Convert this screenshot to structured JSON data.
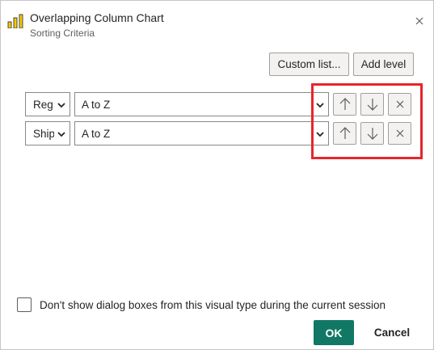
{
  "header": {
    "title": "Overlapping Column Chart",
    "subtitle": "Sorting Criteria",
    "app_icon": "column-chart-icon",
    "close_icon": "close-icon"
  },
  "toolbar": {
    "custom_list_label": "Custom list...",
    "add_level_label": "Add level"
  },
  "sort_rows": [
    {
      "field": "Reg",
      "order": "A to Z"
    },
    {
      "field": "Ship",
      "order": "A to Z"
    }
  ],
  "row_buttons": {
    "up_icon": "arrow-up-icon",
    "down_icon": "arrow-down-icon",
    "delete_icon": "close-icon"
  },
  "footer": {
    "checkbox_label": "Don't show dialog boxes from this visual type during the current session",
    "checkbox_checked": false,
    "ok_label": "OK",
    "cancel_label": "Cancel"
  },
  "colors": {
    "ok_button": "#117865",
    "highlight_border": "#e6262b",
    "icon_yellow": "#f2c811"
  }
}
